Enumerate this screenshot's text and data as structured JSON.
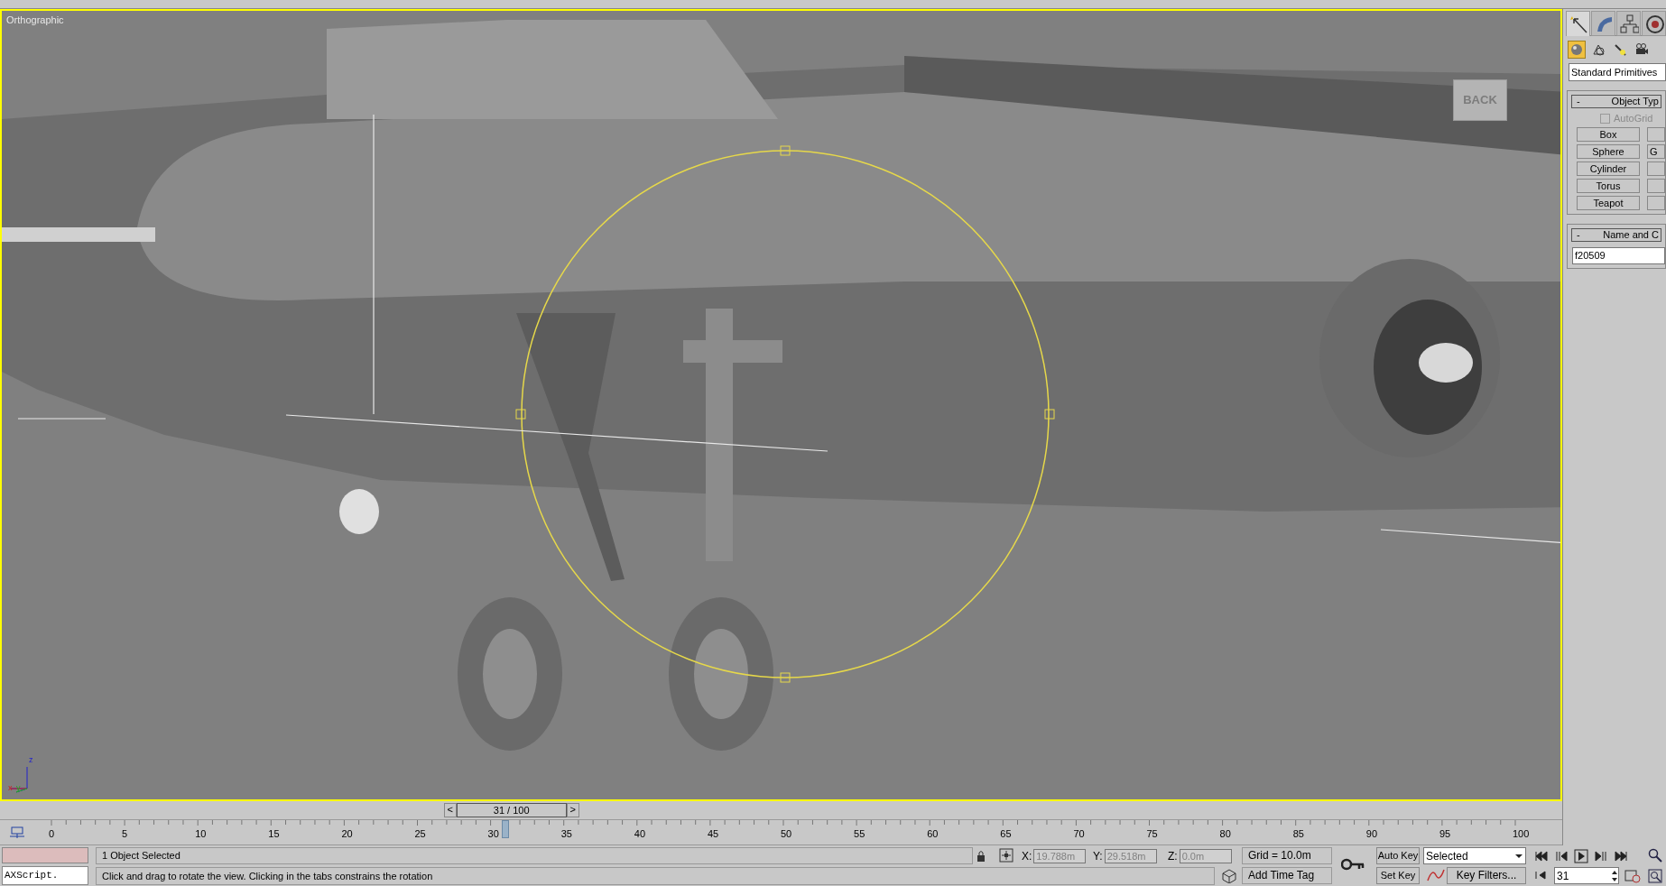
{
  "viewport": {
    "label": "Orthographic",
    "active": true,
    "viewcube_label": "BACK",
    "axis_labels": [
      "x",
      "y",
      "z"
    ]
  },
  "command_panel": {
    "tabs": [
      {
        "kind": "create",
        "selected": true
      },
      {
        "kind": "modify",
        "selected": false
      },
      {
        "kind": "hierarchy",
        "selected": false
      },
      {
        "kind": "motion",
        "selected": false
      }
    ],
    "categories": [
      {
        "kind": "geometry",
        "selected": true
      },
      {
        "kind": "shapes",
        "selected": false
      },
      {
        "kind": "lights",
        "selected": false
      },
      {
        "kind": "cameras",
        "selected": false
      }
    ],
    "dropdown": "Standard Primitives",
    "object_type": {
      "expander": "-",
      "title": "Object Typ",
      "autogrid": {
        "label": "AutoGrid",
        "checked": false,
        "disabled": true
      },
      "buttons": [
        {
          "left": "Box"
        },
        {
          "left": "Sphere",
          "right": "G"
        },
        {
          "left": "Cylinder"
        },
        {
          "left": "Torus"
        },
        {
          "left": "Teapot"
        }
      ]
    },
    "name_and_color": {
      "expander": "-",
      "title": "Name and C",
      "name": "f20509"
    }
  },
  "time_slider": {
    "prev": "<",
    "label": "31 / 100",
    "next": ">",
    "level": 0.31
  },
  "track_bar": {
    "labels": [
      "0",
      "5",
      "10",
      "15",
      "20",
      "25",
      "30",
      "35",
      "40",
      "45",
      "50",
      "55",
      "60",
      "65",
      "70",
      "75",
      "80",
      "85",
      "90",
      "95",
      "100"
    ],
    "level": 0.31
  },
  "status_bar": {
    "maxscript": "AXScript.",
    "selection": "1 Object Selected",
    "prompt": "Click and drag to rotate the view.  Clicking in the tabs constrains the rotation",
    "coords": [
      {
        "axis": "X:",
        "value": "19.788m"
      },
      {
        "axis": "Y:",
        "value": "29.518m"
      },
      {
        "axis": "Z:",
        "value": "0.0m"
      }
    ],
    "grid": "Grid = 10.0m",
    "add_time_tag": "Add Time Tag",
    "auto_key": {
      "label": "Auto Key",
      "on": false
    },
    "set_key": "Set Key",
    "key_mode": "Selected",
    "key_filters": "Key Filters...",
    "frame": "31"
  }
}
